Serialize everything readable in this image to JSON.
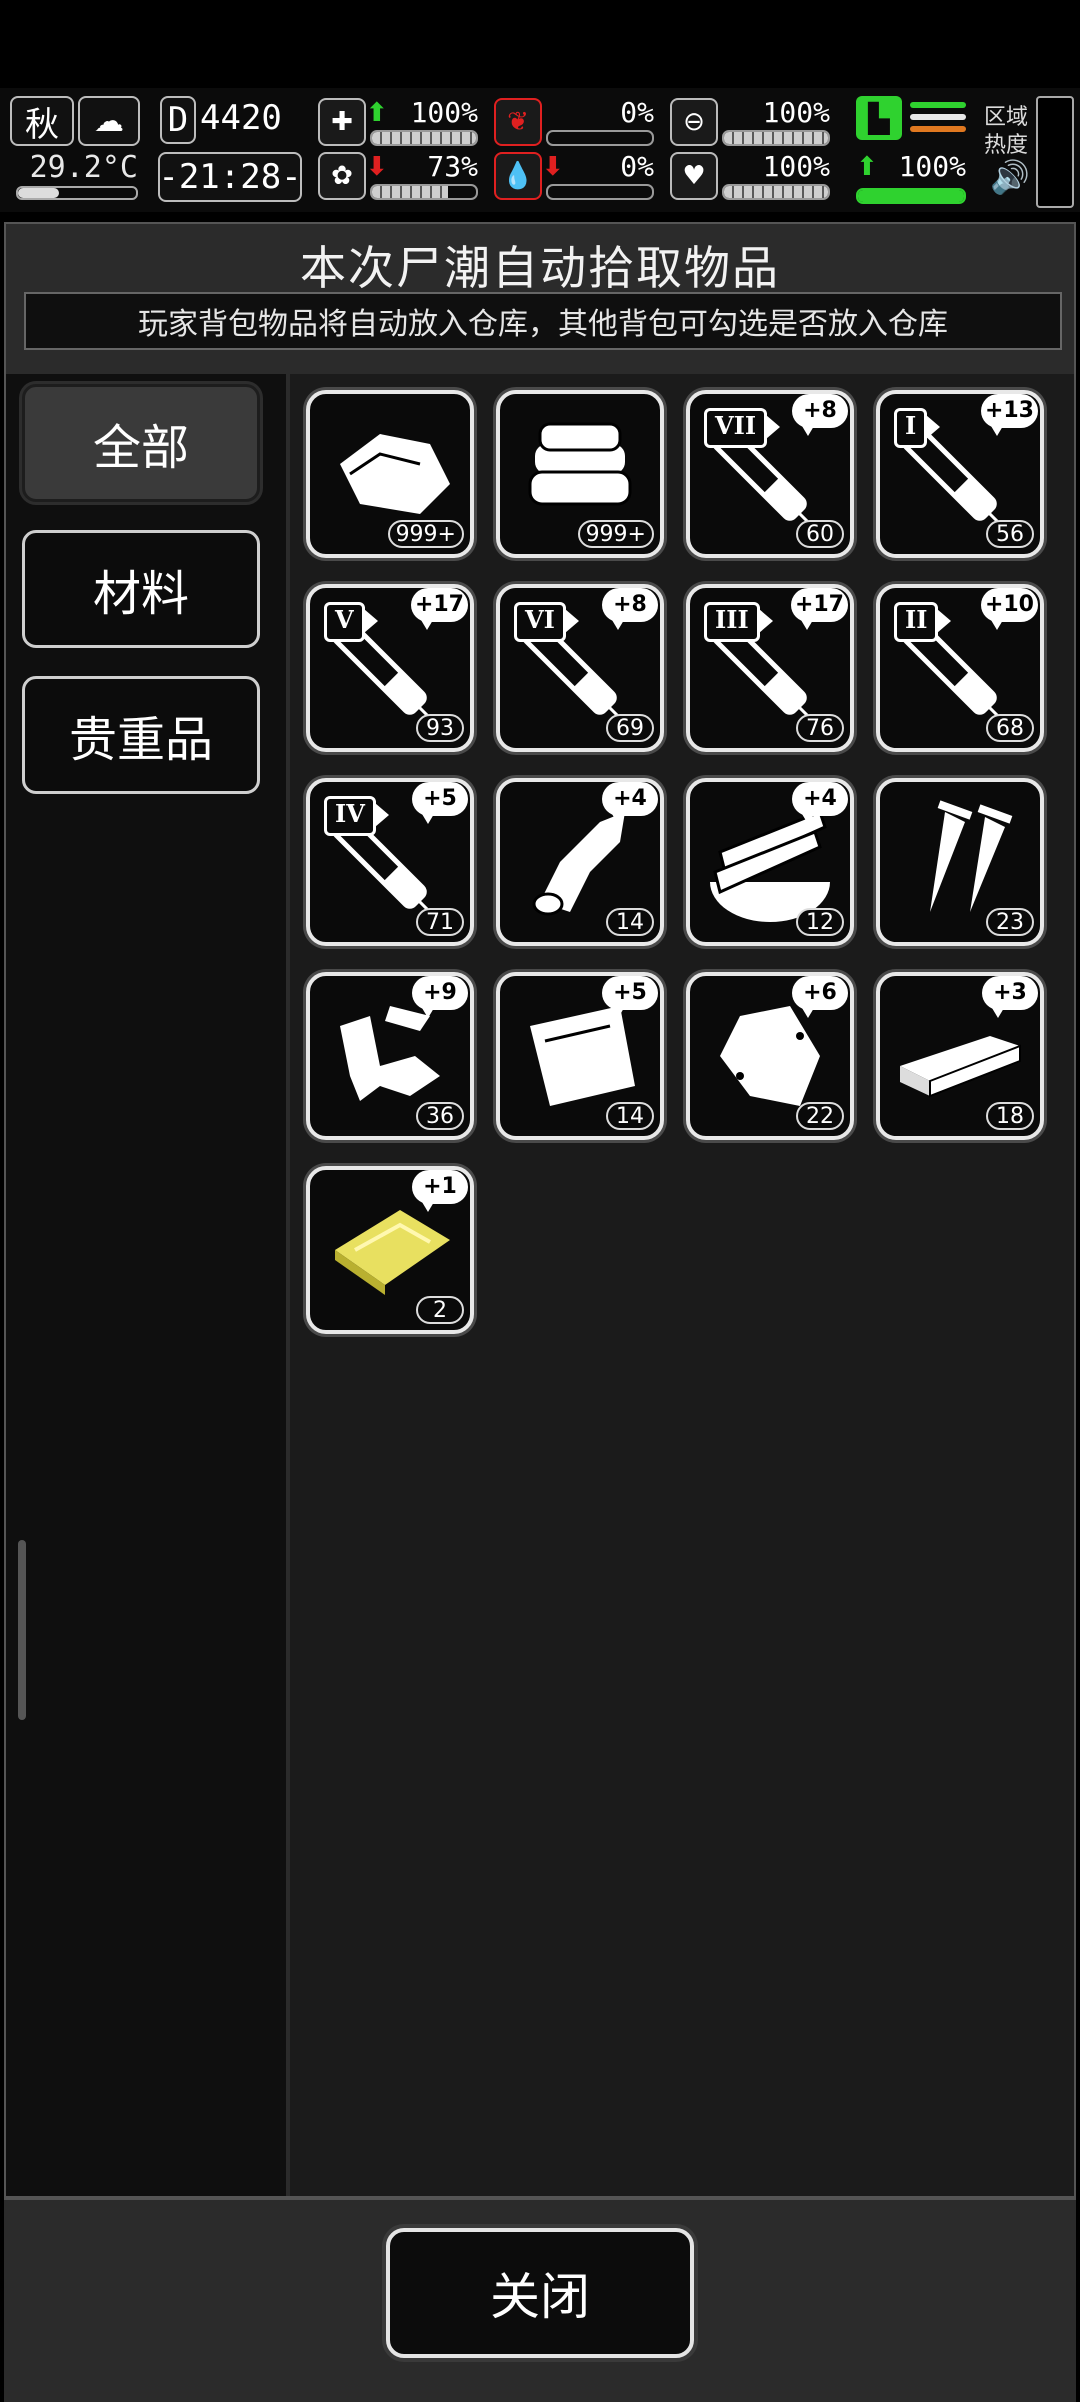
{
  "hud": {
    "season": "秋",
    "temperature": "29.2°C",
    "temperature_level": 0.35,
    "day_label": "D",
    "day_count": "4420",
    "clock": "-21:28-",
    "stats": [
      {
        "icon": "medkit-icon",
        "arrow": "up",
        "value": "100%",
        "level": 1.0
      },
      {
        "icon": "stomach-icon",
        "arrow": "",
        "value": "0%",
        "level": 0.0
      },
      {
        "icon": "pill-icon",
        "arrow": "",
        "value": "100%",
        "level": 1.0
      },
      {
        "icon": "brain-icon",
        "arrow": "down",
        "value": "73%",
        "level": 0.73
      },
      {
        "icon": "blood-drop-icon",
        "arrow": "down",
        "value": "0%",
        "level": 0.0
      },
      {
        "icon": "heart-icon",
        "arrow": "",
        "value": "100%",
        "level": 1.0
      }
    ],
    "stamina_value": "100%",
    "stamina_level": 1.0,
    "zone_label_1": "区域",
    "zone_label_2": "热度",
    "colors": {
      "up": "#2fd22f",
      "down": "#e02020",
      "stamina": "#2fd22f",
      "stamina_stripe": "#e07820"
    }
  },
  "panel": {
    "title": "本次尸潮自动拾取物品",
    "subtitle": "玩家背包物品将自动放入仓库，其他背包可勾选是否放入仓库"
  },
  "categories": [
    "全部",
    "材料",
    "贵重品"
  ],
  "items": [
    {
      "icon": "meat-icon",
      "count": "999+",
      "plus": "",
      "roman": ""
    },
    {
      "icon": "cloth-icon",
      "count": "999+",
      "plus": "",
      "roman": ""
    },
    {
      "icon": "syringe-icon",
      "count": "60",
      "plus": "+8",
      "roman": "VII"
    },
    {
      "icon": "syringe-icon",
      "count": "56",
      "plus": "+13",
      "roman": "I"
    },
    {
      "icon": "syringe-icon",
      "count": "93",
      "plus": "+17",
      "roman": "V"
    },
    {
      "icon": "syringe-icon",
      "count": "69",
      "plus": "+8",
      "roman": "VI"
    },
    {
      "icon": "syringe-icon",
      "count": "76",
      "plus": "+17",
      "roman": "III"
    },
    {
      "icon": "syringe-icon",
      "count": "68",
      "plus": "+10",
      "roman": "II"
    },
    {
      "icon": "syringe-icon",
      "count": "71",
      "plus": "+5",
      "roman": "IV"
    },
    {
      "icon": "leather-icon",
      "count": "14",
      "plus": "+4",
      "roman": ""
    },
    {
      "icon": "wood-planks-icon",
      "count": "12",
      "plus": "+4",
      "roman": ""
    },
    {
      "icon": "nails-icon",
      "count": "23",
      "plus": "",
      "roman": ""
    },
    {
      "icon": "scrap-metal-icon",
      "count": "36",
      "plus": "+9",
      "roman": ""
    },
    {
      "icon": "plastic-sheet-icon",
      "count": "14",
      "plus": "+5",
      "roman": ""
    },
    {
      "icon": "plastic-bag-icon",
      "count": "22",
      "plus": "+6",
      "roman": ""
    },
    {
      "icon": "board-icon",
      "count": "18",
      "plus": "+3",
      "roman": ""
    },
    {
      "icon": "gold-plate-icon",
      "count": "2",
      "plus": "+1",
      "roman": ""
    }
  ],
  "close_label": "关闭"
}
